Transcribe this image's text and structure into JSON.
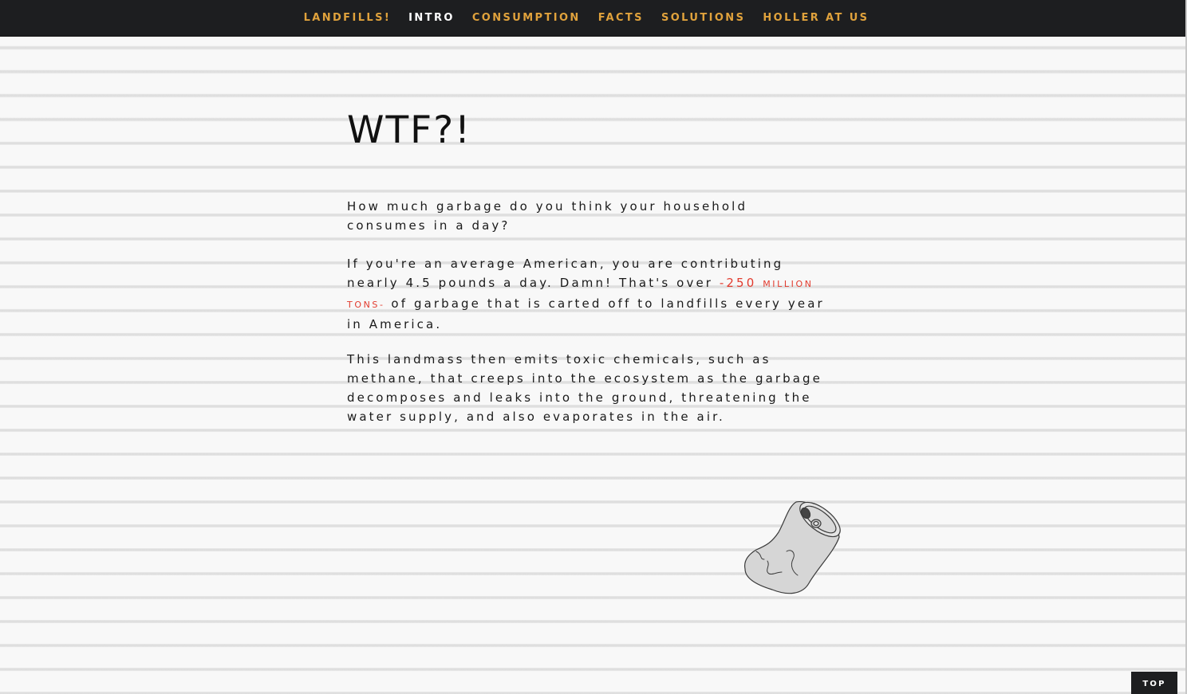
{
  "nav": {
    "items": [
      {
        "label": "LANDFILLS!",
        "active": false
      },
      {
        "label": "INTRO",
        "active": true
      },
      {
        "label": "CONSUMPTION",
        "active": false
      },
      {
        "label": "FACTS",
        "active": false
      },
      {
        "label": "SOLUTIONS",
        "active": false
      },
      {
        "label": "HOLLER AT US",
        "active": false
      }
    ]
  },
  "intro": {
    "headline": "WTF?!",
    "para1": "How much garbage do you think your household consumes in a day?",
    "para2_before": "If you're an average American, you are contributing nearly 4.5 pounds a day. Damn! That's over ",
    "para2_highlight_num": "-250 ",
    "para2_highlight_unit": "million tons-",
    "para2_after": " of garbage that is carted off to landfills every year in America.",
    "para3": "This landmass then emits toxic chemicals, such as methane, that creeps into the ecosystem as the garbage decomposes and leaks into the ground, threatening the water supply, and also evaporates in the air."
  },
  "illustration": {
    "icon": "crushed-can-icon"
  },
  "top_button": {
    "label": "TOP"
  },
  "colors": {
    "nav_bg": "#1d1e20",
    "nav_link": "#e0a23c",
    "nav_active": "#ffffff",
    "highlight": "#e23b2e",
    "text": "#1a1a1a"
  }
}
